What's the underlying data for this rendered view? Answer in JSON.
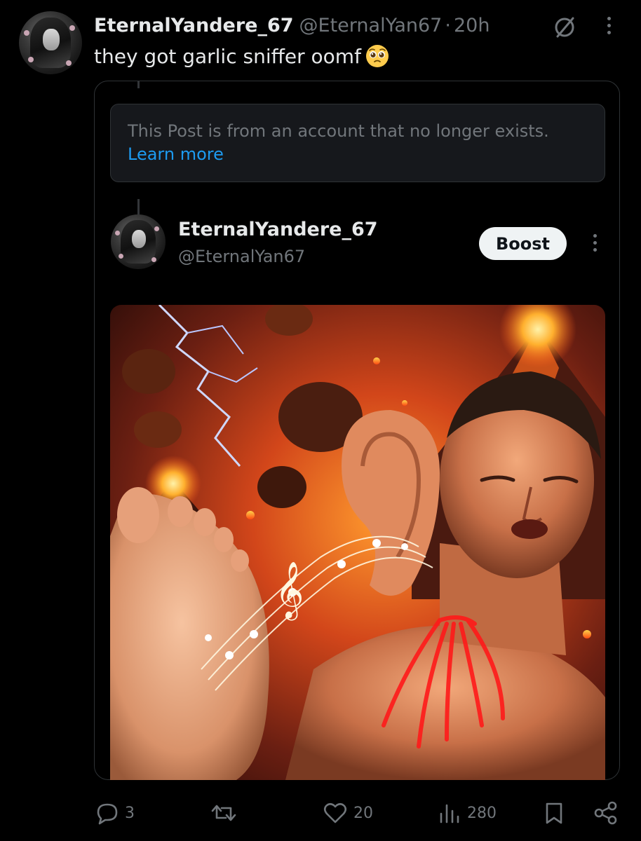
{
  "post": {
    "display_name": "EternalYandere_67",
    "handle": "@EternalYan67",
    "separator": "·",
    "time": "20h",
    "text": "they got garlic sniffer oomf",
    "emoji": "pleading-face"
  },
  "quote": {
    "unavailable_notice": "This Post is from an account that no longer exists.",
    "learn_more_label": "Learn more",
    "display_name": "EternalYandere_67",
    "handle": "@EternalYan67",
    "boost_label": "Boost"
  },
  "actions": {
    "replies": "3",
    "reposts": "",
    "likes": "20",
    "views": "280"
  },
  "colors": {
    "background": "#000000",
    "primary_text": "#e7e9ea",
    "secondary_text": "#71767b",
    "link": "#1d9bf0",
    "border": "#2f3336"
  }
}
